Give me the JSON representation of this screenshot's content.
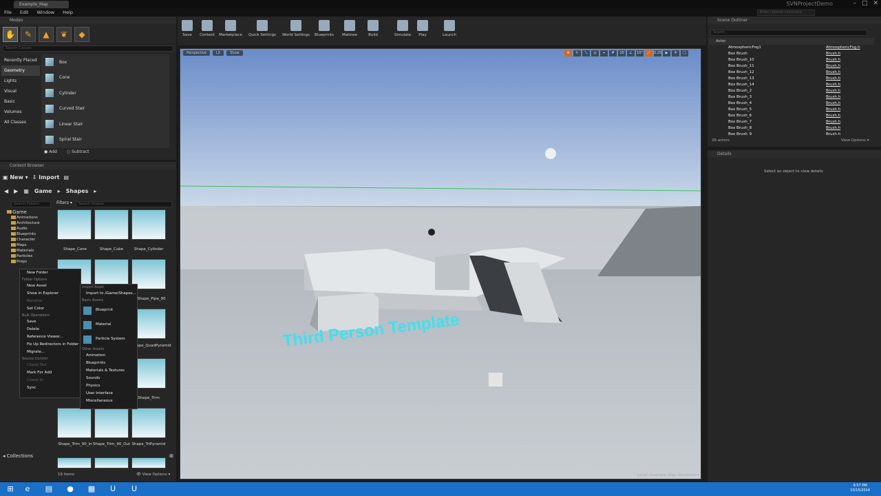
{
  "window": {
    "tab": "Example_Map",
    "project": "SVNProjectDemo",
    "console_placeholder": "Enter console command"
  },
  "menu": [
    "File",
    "Edit",
    "Window",
    "Help"
  ],
  "modes": {
    "title": "Modes",
    "search_placeholder": "Search Classes",
    "categories": [
      "Recently Placed",
      "Geometry",
      "Lights",
      "Visual",
      "Basic",
      "Volumes",
      "All Classes"
    ],
    "shapes": [
      "Box",
      "Cone",
      "Cylinder",
      "Curved Stair",
      "Linear Stair",
      "Spiral Stair"
    ],
    "add": "Add",
    "subtract": "Subtract"
  },
  "content_browser": {
    "title": "Content Browser",
    "new": "New",
    "import": "Import",
    "path": [
      "Game",
      "Shapes"
    ],
    "search_folders": "Search Folders",
    "filters": "Filters",
    "search_shapes": "Search Shapes",
    "tree_root": "Game",
    "tree": [
      "Animations",
      "Architecture",
      "Audio",
      "Blueprints",
      "Character",
      "Maps",
      "Materials",
      "Particles",
      "Props"
    ],
    "tiles": [
      "Shape_Cone",
      "Shape_Cube",
      "Shape_Cylinder",
      "",
      "",
      "Shape_Pipe_90",
      "",
      "",
      "Shape_QuadPyramid",
      "",
      "",
      "Shape_Trim",
      "Shape_Trim_90_In",
      "Shape_Trim_90_Out",
      "Shape_TriPyramid"
    ],
    "collections": "Collections",
    "items": "19 items",
    "view_options": "View Options"
  },
  "context_menu": {
    "items": [
      {
        "t": "New Folder",
        "k": "i"
      },
      {
        "t": "Folder Options",
        "k": "hd"
      },
      {
        "t": "New Asset",
        "k": "i"
      },
      {
        "t": "Show in Explorer",
        "k": "i"
      },
      {
        "t": "Rename",
        "k": "dis"
      },
      {
        "t": "Set Color",
        "k": "i"
      },
      {
        "t": "Bulk Operations",
        "k": "hd"
      },
      {
        "t": "Save",
        "k": "i"
      },
      {
        "t": "Delete",
        "k": "i"
      },
      {
        "t": "Reference Viewer...",
        "k": "i"
      },
      {
        "t": "Fix Up Redirectors in Folder",
        "k": "i"
      },
      {
        "t": "Migrate...",
        "k": "i"
      },
      {
        "t": "Source Control",
        "k": "hd"
      },
      {
        "t": "Check Out",
        "k": "dis"
      },
      {
        "t": "Mark For Add",
        "k": "i"
      },
      {
        "t": "Check In",
        "k": "dis"
      },
      {
        "t": "Sync",
        "k": "i"
      }
    ]
  },
  "submenu": {
    "items": [
      {
        "t": "Import Asset",
        "k": "hd"
      },
      {
        "t": "Import to /Game/Shapes...",
        "k": "i"
      },
      {
        "t": "Basic Assets",
        "k": "hd"
      },
      {
        "t": "Blueprint",
        "k": "big"
      },
      {
        "t": "Material",
        "k": "big"
      },
      {
        "t": "Particle System",
        "k": "big"
      },
      {
        "t": "Other Assets",
        "k": "hd"
      },
      {
        "t": "Animation",
        "k": "i"
      },
      {
        "t": "Blueprints",
        "k": "i"
      },
      {
        "t": "Materials & Textures",
        "k": "i"
      },
      {
        "t": "Sounds",
        "k": "i"
      },
      {
        "t": "Physics",
        "k": "i"
      },
      {
        "t": "User Interface",
        "k": "i"
      },
      {
        "t": "Miscellaneous",
        "k": "i"
      }
    ]
  },
  "toolbar": [
    "Save",
    "Content",
    "Marketplace",
    "Quick Settings",
    "World Settings",
    "Blueprints",
    "Matinee",
    "Build",
    "Simulate",
    "Play",
    "Launch"
  ],
  "viewport": {
    "perspective": "Perspective",
    "lit": "Lit",
    "show": "Show",
    "tools": [
      "10",
      "10°",
      "0.25",
      "4"
    ],
    "overlay_text": "Third Person Template",
    "level": "Level: Example_Map (Persistent)"
  },
  "outliner": {
    "title": "Scene Outliner",
    "search_placeholder": "Search...",
    "col_actor": "Actor",
    "actors": [
      [
        "AtmosphericFog1",
        "AtmosphericFog.h"
      ],
      [
        "Box Brush",
        "Brush.h"
      ],
      [
        "Box Brush_10",
        "Brush.h"
      ],
      [
        "Box Brush_11",
        "Brush.h"
      ],
      [
        "Box Brush_12",
        "Brush.h"
      ],
      [
        "Box Brush_13",
        "Brush.h"
      ],
      [
        "Box Brush_14",
        "Brush.h"
      ],
      [
        "Box Brush_2",
        "Brush.h"
      ],
      [
        "Box Brush_3",
        "Brush.h"
      ],
      [
        "Box Brush_4",
        "Brush.h"
      ],
      [
        "Box Brush_5",
        "Brush.h"
      ],
      [
        "Box Brush_6",
        "Brush.h"
      ],
      [
        "Box Brush_7",
        "Brush.h"
      ],
      [
        "Box Brush_8",
        "Brush.h"
      ],
      [
        "Box Brush_9",
        "Brush.h"
      ]
    ],
    "count": "26 actors",
    "view_options": "View Options"
  },
  "details": {
    "title": "Details",
    "message": "Select an object to view details"
  },
  "clock": {
    "time": "9:57 PM",
    "date": "10/15/2014"
  },
  "colors": {
    "accent": "#1a6fc7",
    "sky_top": "#6a8cc8",
    "ground": "#b8bec4",
    "title_text": "#3ee0f0"
  }
}
